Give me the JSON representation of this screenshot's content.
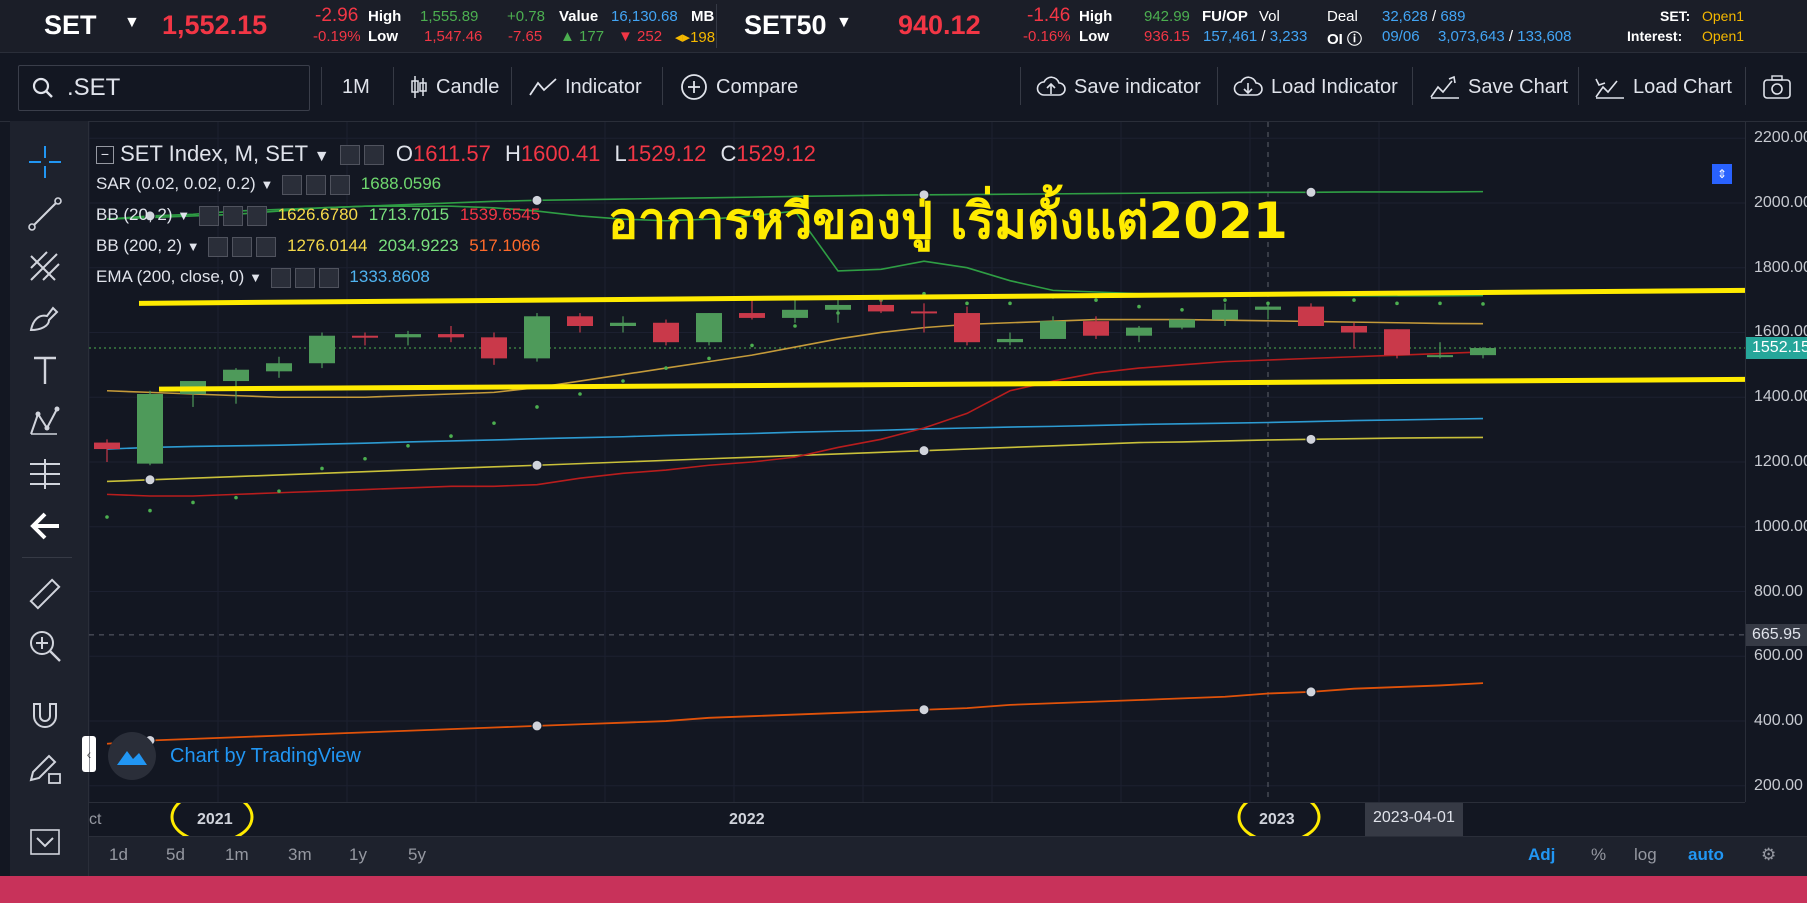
{
  "ticker": {
    "set": {
      "name": "SET",
      "price": "1,552.15",
      "chg": "-2.96",
      "pct": "-0.19%",
      "high_label": "High",
      "low_label": "Low",
      "high": "1,555.89",
      "low": "1,547.46",
      "chg2": "+0.78",
      "chg3": "-7.65",
      "value_label": "Value",
      "value": "16,130.68",
      "unit": "MB",
      "up": "177",
      "down": "252",
      "unch": "198"
    },
    "set50": {
      "name": "SET50",
      "price": "940.12",
      "chg": "-1.46",
      "pct": "-0.16%",
      "high_label": "High",
      "low_label": "Low",
      "high": "942.99",
      "low": "936.15"
    },
    "fuop": {
      "label": "FU/OP",
      "vol_label": "Vol",
      "deal_label": "Deal",
      "vol1": "157,461",
      "vol2": "3,233",
      "deal1": "32,628",
      "deal2": "689",
      "oi_label": "OI",
      "date": "09/06",
      "oi1": "3,073,643",
      "oi2": "133,608"
    },
    "status": {
      "set_label": "SET:",
      "set_val": "Open1",
      "int_label": "Interest:",
      "int_val": "Open1"
    }
  },
  "toolbar": {
    "search_value": ".SET",
    "interval": "1M",
    "candle": "Candle",
    "indicator": "Indicator",
    "compare": "Compare",
    "save_indicator": "Save indicator",
    "load_indicator": "Load Indicator",
    "save_chart": "Save Chart",
    "load_chart": "Load Chart"
  },
  "legend": {
    "title": "SET Index, M, SET",
    "o_label": "O",
    "o": "1611.57",
    "h_label": "H",
    "h": "1600.41",
    "l_label": "L",
    "l": "1529.12",
    "c_label": "C",
    "c": "1529.12",
    "sar": "SAR (0.02, 0.02, 0.2)",
    "sar_val": "1688.0596",
    "bb20": "BB (20, 2)",
    "bb20_mid": "1626.6780",
    "bb20_up": "1713.7015",
    "bb20_low": "1539.6545",
    "bb200": "BB (200, 2)",
    "bb200_mid": "1276.0144",
    "bb200_up": "2034.9223",
    "bb200_low": "517.1066",
    "ema": "EMA (200, close, 0)",
    "ema_val": "1333.8608"
  },
  "annotation": "อาการหวีของปู่ เริ่มตั้งแต่2021",
  "watermark": "Chart by TradingView",
  "price_axis": {
    "labels": [
      "2200.00",
      "2000.00",
      "1800.00",
      "1600.00",
      "1400.00",
      "1200.00",
      "1000.00",
      "800.00",
      "600.00",
      "400.00",
      "200.00"
    ],
    "last": "1552.15",
    "cursor": "665.95"
  },
  "time_axis": {
    "left_cut": "ct",
    "labels": [
      "2021",
      "2022",
      "2023"
    ],
    "cursor": "2023-04-01"
  },
  "bottom": {
    "ranges": [
      "1d",
      "5d",
      "1m",
      "3m",
      "1y",
      "5y"
    ],
    "adj": "Adj",
    "pct": "%",
    "log": "log",
    "auto": "auto"
  },
  "colors": {
    "up": "#4e9a5a",
    "down": "#c9394a",
    "sar": "#4caf50",
    "bb20": "#c49a3a",
    "bb200": "#2f9e44",
    "bb200_low": "#e0520a",
    "ema": "#2d9bd2",
    "highlight": "#ffeb00"
  },
  "chart_data": {
    "type": "candlestick",
    "ylim": [
      150,
      2250
    ],
    "x": [
      "2020-10",
      "2020-11",
      "2020-12",
      "2021-01",
      "2021-02",
      "2021-03",
      "2021-04",
      "2021-05",
      "2021-06",
      "2021-07",
      "2021-08",
      "2021-09",
      "2021-10",
      "2021-11",
      "2021-12",
      "2022-01",
      "2022-02",
      "2022-03",
      "2022-04",
      "2022-05",
      "2022-06",
      "2022-07",
      "2022-08",
      "2022-09",
      "2022-10",
      "2022-11",
      "2022-12",
      "2023-01",
      "2023-02",
      "2023-03",
      "2023-04",
      "2023-05",
      "2023-06"
    ],
    "ohlc": [
      [
        1260,
        1270,
        1200,
        1240
      ],
      [
        1195,
        1420,
        1190,
        1410
      ],
      [
        1410,
        1445,
        1370,
        1450
      ],
      [
        1450,
        1490,
        1380,
        1485
      ],
      [
        1480,
        1525,
        1460,
        1505
      ],
      [
        1505,
        1600,
        1490,
        1590
      ],
      [
        1590,
        1600,
        1560,
        1585
      ],
      [
        1585,
        1605,
        1560,
        1595
      ],
      [
        1595,
        1620,
        1570,
        1585
      ],
      [
        1585,
        1600,
        1500,
        1520
      ],
      [
        1520,
        1660,
        1510,
        1650
      ],
      [
        1650,
        1660,
        1600,
        1620
      ],
      [
        1620,
        1650,
        1600,
        1630
      ],
      [
        1630,
        1640,
        1560,
        1570
      ],
      [
        1570,
        1660,
        1560,
        1660
      ],
      [
        1660,
        1700,
        1640,
        1645
      ],
      [
        1645,
        1700,
        1630,
        1670
      ],
      [
        1670,
        1700,
        1630,
        1685
      ],
      [
        1685,
        1710,
        1660,
        1665
      ],
      [
        1665,
        1690,
        1600,
        1660
      ],
      [
        1660,
        1680,
        1560,
        1570
      ],
      [
        1570,
        1600,
        1560,
        1580
      ],
      [
        1580,
        1650,
        1580,
        1635
      ],
      [
        1635,
        1650,
        1580,
        1590
      ],
      [
        1590,
        1620,
        1570,
        1615
      ],
      [
        1615,
        1640,
        1610,
        1640
      ],
      [
        1640,
        1690,
        1620,
        1670
      ],
      [
        1670,
        1690,
        1640,
        1680
      ],
      [
        1680,
        1690,
        1620,
        1620
      ],
      [
        1620,
        1630,
        1550,
        1600
      ],
      [
        1610,
        1610,
        1520,
        1530
      ],
      [
        1530,
        1570,
        1520,
        1530
      ],
      [
        1530,
        1555,
        1520,
        1552
      ]
    ],
    "sar": [
      1030,
      1050,
      1075,
      1090,
      1110,
      1180,
      1210,
      1250,
      1280,
      1320,
      1370,
      1410,
      1450,
      1490,
      1520,
      1560,
      1620,
      1660,
      1700,
      1720,
      1690,
      1690,
      1710,
      1700,
      1680,
      1670,
      1700,
      1690,
      1720,
      1700,
      1690,
      1690,
      1688
    ],
    "bb20_mid": [
      1420,
      1415,
      1410,
      1405,
      1400,
      1400,
      1400,
      1405,
      1410,
      1415,
      1430,
      1450,
      1470,
      1490,
      1510,
      1530,
      1555,
      1580,
      1600,
      1615,
      1625,
      1630,
      1635,
      1640,
      1640,
      1640,
      1638,
      1636,
      1634,
      1632,
      1630,
      1628,
      1627
    ],
    "bb20_up": [
      1950,
      1955,
      1960,
      1965,
      1975,
      1985,
      1990,
      1990,
      1990,
      1985,
      1975,
      1960,
      1950,
      1945,
      1950,
      1960,
      1975,
      1790,
      1795,
      1820,
      1800,
      1760,
      1730,
      1725,
      1720,
      1720,
      1718,
      1716,
      1714,
      1713,
      1713,
      1713,
      1714
    ],
    "bb20_low": [
      1100,
      1095,
      1095,
      1100,
      1105,
      1110,
      1115,
      1120,
      1125,
      1125,
      1130,
      1150,
      1165,
      1175,
      1190,
      1200,
      1215,
      1245,
      1270,
      1305,
      1350,
      1420,
      1450,
      1475,
      1490,
      1500,
      1510,
      1515,
      1520,
      1525,
      1530,
      1535,
      1540
    ],
    "bb200_up": [
      1950,
      1960,
      1965,
      1975,
      1980,
      1985,
      1990,
      1995,
      2000,
      2005,
      2008,
      2010,
      2012,
      2014,
      2016,
      2018,
      2020,
      2022,
      2024,
      2025,
      2026,
      2027,
      2028,
      2029,
      2030,
      2031,
      2032,
      2033,
      2033,
      2034,
      2034,
      2034,
      2035
    ],
    "bb200_mid": [
      1140,
      1145,
      1150,
      1155,
      1160,
      1165,
      1170,
      1175,
      1180,
      1185,
      1190,
      1195,
      1200,
      1205,
      1210,
      1215,
      1220,
      1225,
      1230,
      1235,
      1240,
      1245,
      1250,
      1255,
      1260,
      1262,
      1265,
      1268,
      1270,
      1272,
      1274,
      1275,
      1276
    ],
    "bb200_low": [
      330,
      340,
      345,
      350,
      355,
      360,
      365,
      370,
      375,
      380,
      385,
      390,
      395,
      400,
      410,
      415,
      420,
      425,
      430,
      435,
      440,
      450,
      455,
      460,
      465,
      470,
      475,
      485,
      490,
      500,
      505,
      510,
      517
    ],
    "ema": [
      1240,
      1245,
      1248,
      1250,
      1252,
      1255,
      1258,
      1262,
      1265,
      1268,
      1272,
      1275,
      1278,
      1282,
      1285,
      1288,
      1292,
      1295,
      1298,
      1302,
      1305,
      1308,
      1310,
      1313,
      1316,
      1318,
      1320,
      1322,
      1325,
      1328,
      1330,
      1332,
      1334
    ]
  }
}
